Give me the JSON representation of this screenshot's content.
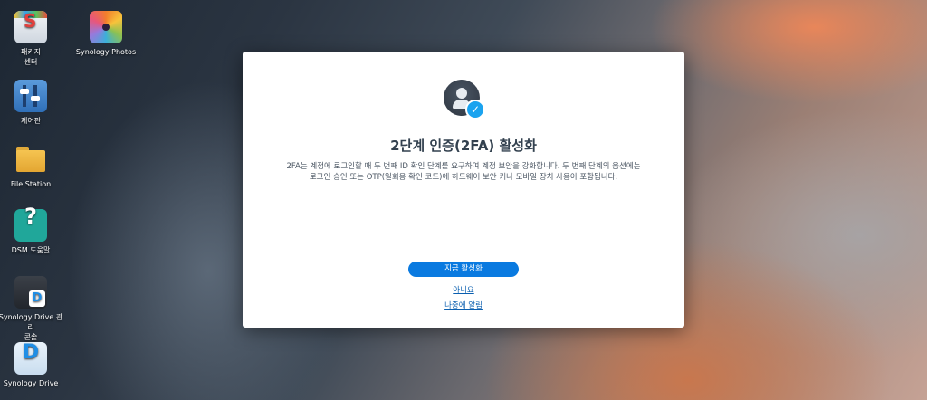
{
  "desktop": {
    "icons": [
      {
        "label": "패키지\n센터",
        "icon": "package-center-icon"
      },
      {
        "label": "제어판",
        "icon": "control-panel-icon"
      },
      {
        "label": "File Station",
        "icon": "folder-icon"
      },
      {
        "label": "DSM 도움말",
        "icon": "help-icon"
      },
      {
        "label": "Synology Drive 관리\n콘솔",
        "icon": "drive-admin-console-icon"
      },
      {
        "label": "Synology Drive",
        "icon": "drive-icon"
      },
      {
        "label": "Synology Photos",
        "icon": "photos-icon"
      }
    ]
  },
  "dialog": {
    "icon": "user-shield-check-icon",
    "title": "2단계 인증(2FA) 활성화",
    "description": "2FA는 계정에 로그인할 때 두 번째 ID 확인 단계를 요구하여 계정 보안을 강화합니다. 두 번째 단계의 옵션에는 로그인 승인 또는 OTP(일회용 확인 코드)에 하드웨어 보안 키나 모바일 장치 사용이 포함됩니다.",
    "primary_button": "지금 활성화",
    "no_link": "아니요",
    "later_link": "나중에 알림"
  }
}
